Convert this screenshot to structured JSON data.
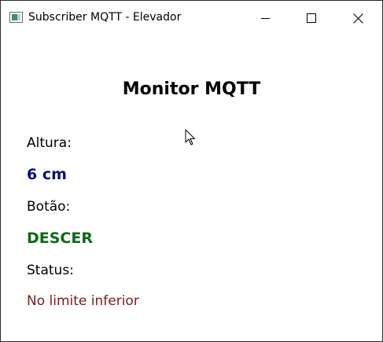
{
  "window": {
    "title": "Subscriber MQTT - Elevador"
  },
  "icons": {
    "app": "window-app-icon",
    "minimize": "minimize-icon",
    "maximize": "maximize-icon",
    "close": "close-icon",
    "cursor": "mouse-pointer-icon"
  },
  "main": {
    "heading": "Monitor MQTT",
    "altura_label": "Altura:",
    "altura_value": "6 cm",
    "botao_label": "Botão:",
    "botao_value": "DESCER",
    "status_label": "Status:",
    "status_value": "No limite inferior"
  },
  "colors": {
    "altura_value": "#0b0b80",
    "botao_value": "#0c6a16",
    "status_value": "#7a1c1c"
  }
}
